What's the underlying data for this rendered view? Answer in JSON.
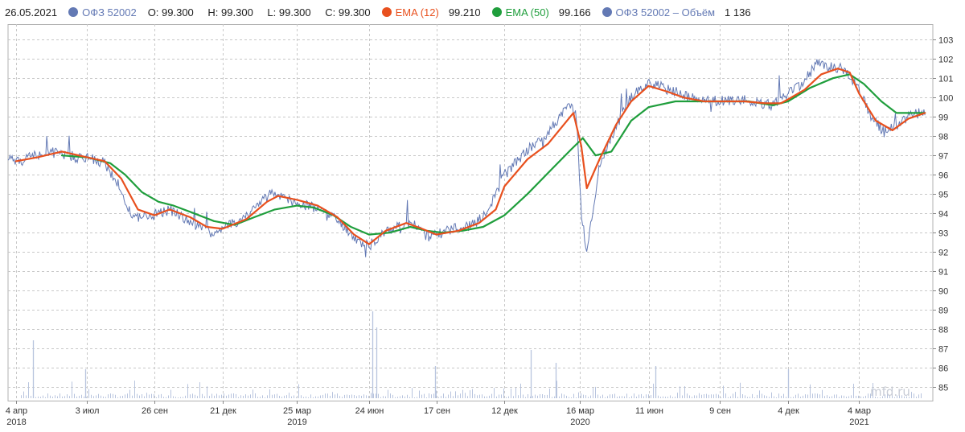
{
  "legend": {
    "date": "26.05.2021",
    "instrument": "ОФЗ 52002",
    "open": "O: 99.300",
    "high": "H: 99.300",
    "low": "L: 99.300",
    "close": "C: 99.300",
    "ema12_label": "EMA (12)",
    "ema12_value": "99.210",
    "ema50_label": "EMA (50)",
    "ema50_value": "99.166",
    "volume_label": "ОФЗ 52002 – Объём",
    "volume_value": "1 136"
  },
  "watermark": "mfd.ru",
  "colors": {
    "price": "#6379b4",
    "ema12": "#e8501e",
    "ema50": "#1f9e3c",
    "volume": "#b8c4de",
    "grid": "#c8c8c8"
  },
  "chart_data": {
    "type": "line",
    "y_ticks": [
      85,
      86,
      87,
      88,
      89,
      90,
      91,
      92,
      93,
      94,
      95,
      96,
      97,
      98,
      99,
      100,
      101,
      102,
      103
    ],
    "ylim": [
      84.3,
      103.8
    ],
    "x_ticks": [
      {
        "label": "4 апр",
        "sub": "2018",
        "date": "2018-04-04"
      },
      {
        "label": "3 июл",
        "sub": "",
        "date": "2018-07-03"
      },
      {
        "label": "26 сен",
        "sub": "",
        "date": "2018-09-26"
      },
      {
        "label": "21 дек",
        "sub": "",
        "date": "2018-12-21"
      },
      {
        "label": "25 мар",
        "sub": "2019",
        "date": "2019-03-25"
      },
      {
        "label": "24 июн",
        "sub": "",
        "date": "2019-06-24"
      },
      {
        "label": "17 сен",
        "sub": "",
        "date": "2019-09-17"
      },
      {
        "label": "12 дек",
        "sub": "",
        "date": "2019-12-12"
      },
      {
        "label": "16 мар",
        "sub": "2020",
        "date": "2020-03-16"
      },
      {
        "label": "11 июн",
        "sub": "",
        "date": "2020-06-11"
      },
      {
        "label": "9 сен",
        "sub": "",
        "date": "2020-09-09"
      },
      {
        "label": "4 дек",
        "sub": "",
        "date": "2020-12-04"
      },
      {
        "label": "4 мар",
        "sub": "2021",
        "date": "2021-03-04"
      }
    ],
    "price_series": {
      "name": "ОФЗ 52002",
      "x": [
        "2018-03-25",
        "2018-04-04",
        "2018-04-20",
        "2018-05-10",
        "2018-06-01",
        "2018-06-20",
        "2018-07-03",
        "2018-07-25",
        "2018-08-10",
        "2018-08-20",
        "2018-09-01",
        "2018-09-26",
        "2018-10-15",
        "2018-11-01",
        "2018-11-20",
        "2018-12-05",
        "2018-12-21",
        "2019-01-15",
        "2019-02-05",
        "2019-02-20",
        "2019-03-10",
        "2019-03-25",
        "2019-04-15",
        "2019-05-05",
        "2019-05-25",
        "2019-06-10",
        "2019-06-24",
        "2019-07-15",
        "2019-08-05",
        "2019-08-25",
        "2019-09-05",
        "2019-09-17",
        "2019-10-10",
        "2019-11-01",
        "2019-11-20",
        "2019-12-12",
        "2020-01-10",
        "2020-02-01",
        "2020-02-20",
        "2020-03-05",
        "2020-03-12",
        "2020-03-18",
        "2020-03-25",
        "2020-04-10",
        "2020-05-01",
        "2020-05-20",
        "2020-06-11",
        "2020-07-01",
        "2020-07-20",
        "2020-08-10",
        "2020-09-09",
        "2020-10-05",
        "2020-10-25",
        "2020-11-15",
        "2020-12-04",
        "2020-12-20",
        "2021-01-10",
        "2021-01-25",
        "2021-02-10",
        "2021-03-04",
        "2021-03-20",
        "2021-04-05",
        "2021-04-20",
        "2021-05-05",
        "2021-05-26"
      ],
      "y": [
        97.0,
        96.6,
        96.9,
        97.2,
        97.1,
        96.9,
        96.9,
        96.6,
        95.6,
        94.5,
        93.8,
        93.9,
        94.2,
        93.8,
        93.3,
        93.0,
        93.2,
        93.7,
        94.5,
        95.0,
        94.8,
        94.5,
        94.3,
        94.0,
        93.3,
        92.6,
        92.3,
        93.1,
        93.4,
        93.4,
        92.8,
        92.9,
        93.2,
        93.4,
        94.0,
        96.0,
        97.3,
        98.0,
        99.0,
        99.7,
        99.0,
        94.0,
        92.0,
        96.5,
        98.5,
        100.0,
        100.8,
        100.5,
        100.2,
        99.9,
        99.8,
        99.9,
        99.7,
        99.6,
        100.2,
        100.6,
        101.8,
        101.6,
        101.5,
        100.5,
        98.9,
        98.2,
        98.5,
        99.0,
        99.3
      ]
    },
    "ema12": {
      "name": "EMA (12)",
      "x": [
        "2018-04-04",
        "2018-05-01",
        "2018-06-01",
        "2018-07-03",
        "2018-07-25",
        "2018-08-15",
        "2018-09-05",
        "2018-09-26",
        "2018-10-15",
        "2018-11-10",
        "2018-12-01",
        "2018-12-21",
        "2019-01-20",
        "2019-02-15",
        "2019-03-01",
        "2019-03-25",
        "2019-04-20",
        "2019-05-15",
        "2019-06-05",
        "2019-06-24",
        "2019-07-15",
        "2019-08-10",
        "2019-08-30",
        "2019-09-17",
        "2019-10-15",
        "2019-11-10",
        "2019-12-01",
        "2019-12-12",
        "2020-01-10",
        "2020-02-05",
        "2020-02-25",
        "2020-03-08",
        "2020-03-18",
        "2020-03-25",
        "2020-04-10",
        "2020-05-01",
        "2020-05-20",
        "2020-06-11",
        "2020-07-05",
        "2020-07-25",
        "2020-08-20",
        "2020-09-09",
        "2020-10-10",
        "2020-11-05",
        "2020-11-25",
        "2020-12-04",
        "2020-12-25",
        "2021-01-15",
        "2021-02-05",
        "2021-02-20",
        "2021-03-04",
        "2021-03-25",
        "2021-04-15",
        "2021-05-05",
        "2021-05-26"
      ],
      "y": [
        96.7,
        96.9,
        97.2,
        96.9,
        96.7,
        95.8,
        94.2,
        93.9,
        94.2,
        93.8,
        93.3,
        93.2,
        93.7,
        94.6,
        94.9,
        94.7,
        94.4,
        93.8,
        92.9,
        92.4,
        93.1,
        93.5,
        93.2,
        92.9,
        93.1,
        93.5,
        94.2,
        95.4,
        96.8,
        97.6,
        98.6,
        99.2,
        97.5,
        95.3,
        96.8,
        98.6,
        99.8,
        100.6,
        100.3,
        100.0,
        99.8,
        99.8,
        99.8,
        99.7,
        99.7,
        99.9,
        100.4,
        101.2,
        101.5,
        101.3,
        100.2,
        98.8,
        98.3,
        98.9,
        99.2
      ]
    },
    "ema50": {
      "name": "EMA (50)",
      "x": [
        "2018-06-01",
        "2018-07-03",
        "2018-08-01",
        "2018-08-20",
        "2018-09-10",
        "2018-10-01",
        "2018-10-20",
        "2018-11-15",
        "2018-12-10",
        "2019-01-05",
        "2019-01-30",
        "2019-02-25",
        "2019-03-25",
        "2019-04-15",
        "2019-05-10",
        "2019-06-01",
        "2019-06-24",
        "2019-07-20",
        "2019-08-15",
        "2019-09-05",
        "2019-09-25",
        "2019-10-20",
        "2019-11-15",
        "2019-12-12",
        "2020-01-10",
        "2020-02-10",
        "2020-03-05",
        "2020-03-20",
        "2020-04-05",
        "2020-04-25",
        "2020-05-20",
        "2020-06-11",
        "2020-07-15",
        "2020-08-15",
        "2020-09-09",
        "2020-10-15",
        "2020-11-15",
        "2020-12-04",
        "2021-01-01",
        "2021-01-30",
        "2021-02-20",
        "2021-03-10",
        "2021-04-01",
        "2021-04-20",
        "2021-05-26"
      ],
      "y": [
        97.0,
        96.9,
        96.6,
        96.0,
        95.1,
        94.6,
        94.4,
        94.0,
        93.6,
        93.4,
        93.8,
        94.2,
        94.4,
        94.3,
        93.9,
        93.3,
        92.9,
        93.0,
        93.3,
        93.1,
        93.0,
        93.1,
        93.3,
        93.9,
        95.0,
        96.3,
        97.3,
        97.9,
        97.0,
        97.2,
        98.8,
        99.5,
        99.8,
        99.8,
        99.8,
        99.8,
        99.6,
        99.8,
        100.5,
        101.0,
        101.2,
        100.7,
        99.8,
        99.2,
        99.2
      ]
    },
    "volume": {
      "name": "ОФЗ 52002 – Объём",
      "last": "1 136",
      "spikes": [
        {
          "date": "2018-04-25",
          "rel": 0.9
        },
        {
          "date": "2018-07-01",
          "rel": 0.45
        },
        {
          "date": "2019-06-28",
          "rel": 1.35
        },
        {
          "date": "2019-07-03",
          "rel": 1.1
        },
        {
          "date": "2019-09-15",
          "rel": 0.5
        },
        {
          "date": "2020-01-14",
          "rel": 0.75
        },
        {
          "date": "2020-02-15",
          "rel": 0.55
        },
        {
          "date": "2020-06-20",
          "rel": 0.5
        },
        {
          "date": "2020-12-04",
          "rel": 0.45
        }
      ]
    }
  }
}
